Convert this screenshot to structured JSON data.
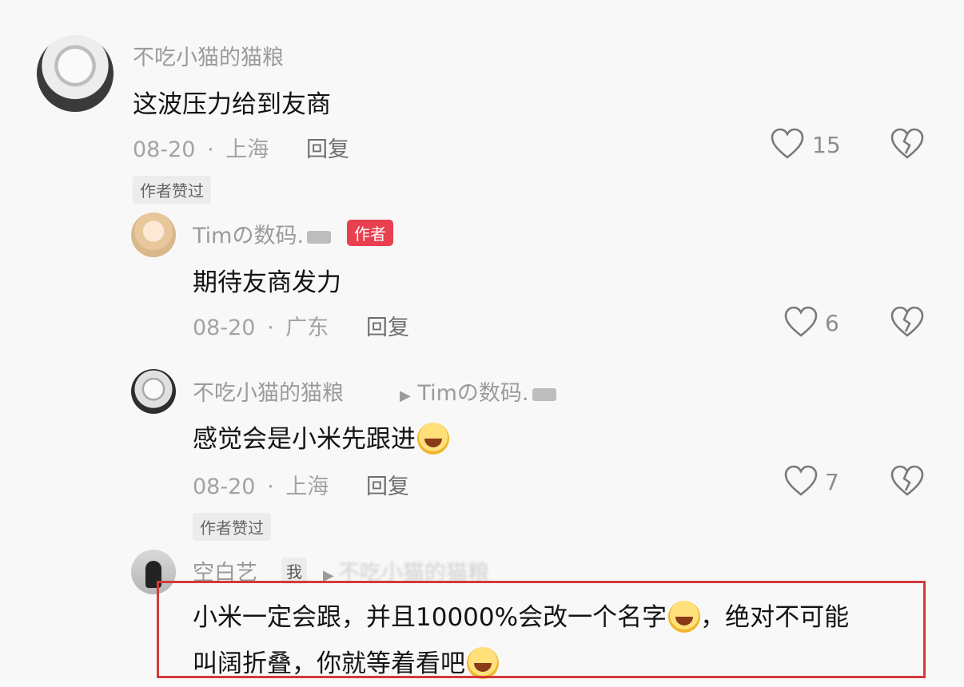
{
  "comments": [
    {
      "username": "不吃小猫的猫粮",
      "text": "这波压力给到友商",
      "date": "08-20",
      "sep": "·",
      "location": "上海",
      "reply_label": "回复",
      "likes": "15",
      "liked_badge": "作者赞过"
    },
    {
      "username": "Timの数码.",
      "author_badge": "作者",
      "text": "期待友商发力",
      "date": "08-20",
      "sep": "·",
      "location": "广东",
      "reply_label": "回复",
      "likes": "6"
    },
    {
      "username": "不吃小猫的猫粮",
      "reply_to": "Timの数码.",
      "text": "感觉会是小米先跟进",
      "date": "08-20",
      "sep": "·",
      "location": "上海",
      "reply_label": "回复",
      "likes": "7",
      "liked_badge": "作者赞过"
    },
    {
      "username": "空白艺",
      "me_badge": "我",
      "reply_to_obscured": "不吃小猫的猫粮",
      "text_line1_a": "小米一定会跟，并且10000%会改一个名字",
      "text_line1_b": "，绝对不可能",
      "text_line2": "叫阔折叠，你就等着看吧"
    }
  ],
  "icons": {
    "heart": "heart-outline-icon",
    "dislike": "broken-heart-icon",
    "camera": "camera-icon",
    "emoji_grin": "grinning-sweat-emoji",
    "emoji_laugh": "laughing-crying-emoji"
  },
  "colors": {
    "author_badge": "#e8404f",
    "highlight_border": "#d43a3a"
  }
}
